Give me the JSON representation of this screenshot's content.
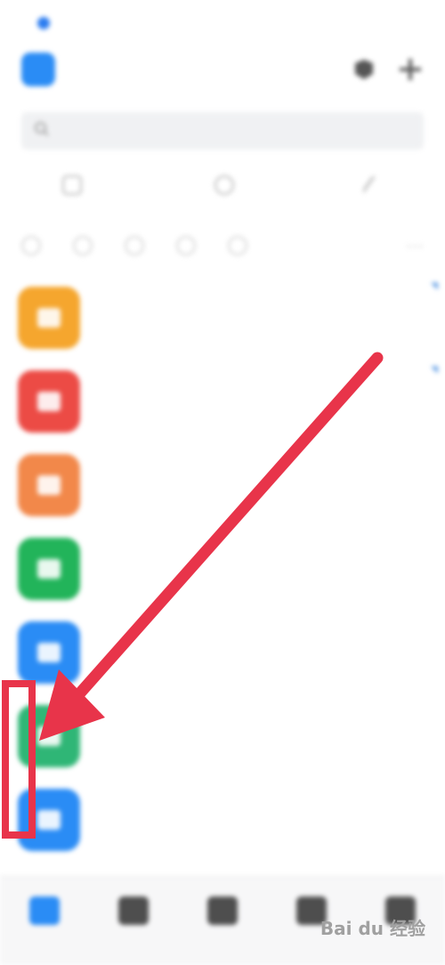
{
  "status_bar": {
    "time": "",
    "icons": ""
  },
  "header": {
    "org_name": "",
    "contacts_icon": "contacts-icon",
    "add_icon": "plus-icon"
  },
  "search": {
    "placeholder": ""
  },
  "quick_actions": [
    {
      "icon": "doc-icon",
      "label": ""
    },
    {
      "icon": "calendar-icon",
      "label": ""
    },
    {
      "icon": "pen-icon",
      "label": ""
    }
  ],
  "chats": [
    {
      "name": "",
      "preview": "",
      "time": "",
      "avatar_color": "#f5a62e"
    },
    {
      "name": "",
      "preview": "",
      "time": "",
      "avatar_color": "#ec4b45"
    },
    {
      "name": "",
      "preview": "",
      "time": "",
      "avatar_color": "#f2884a"
    },
    {
      "name": "",
      "preview": "",
      "time": "",
      "avatar_color": "#22b45a"
    },
    {
      "name": "",
      "preview": "",
      "time": "",
      "avatar_color": "#2a8cf5"
    },
    {
      "name": "",
      "preview": "",
      "time": "",
      "avatar_color": "#2fb676"
    },
    {
      "name": "",
      "preview": "",
      "time": "",
      "avatar_color": "#2a8cf5"
    }
  ],
  "tabs": [
    {
      "icon": "message-icon",
      "label": "",
      "active": true
    },
    {
      "icon": "home-icon",
      "label": ""
    },
    {
      "icon": "apps-icon",
      "label": ""
    },
    {
      "icon": "grid-icon",
      "label": ""
    },
    {
      "icon": "profile-icon",
      "label": ""
    }
  ],
  "annotation": {
    "arrow_color": "#e8344a"
  },
  "watermark": {
    "text": "Bai du 经验"
  }
}
